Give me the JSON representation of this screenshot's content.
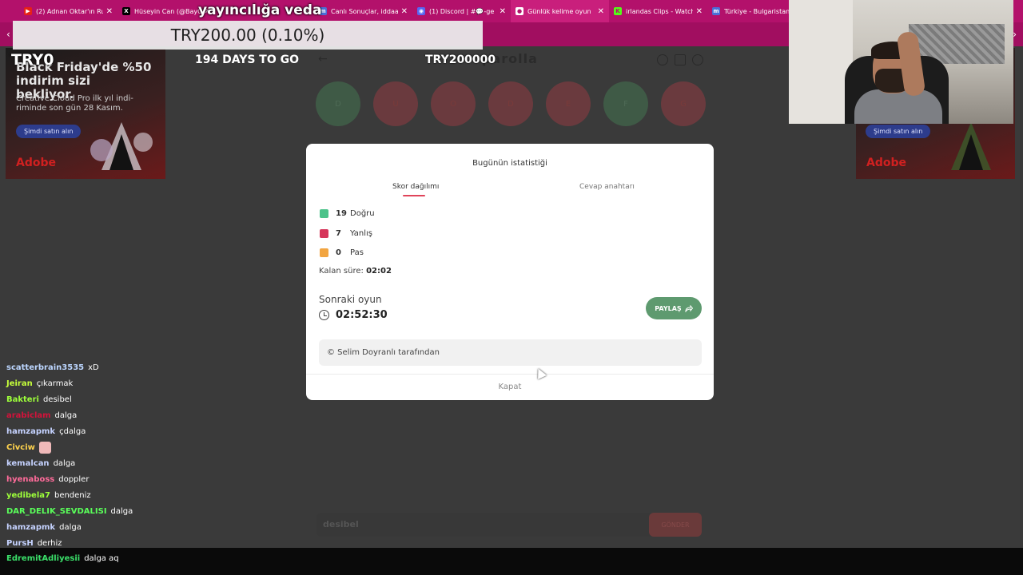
{
  "browser": {
    "tabs": [
      {
        "title": "(2) Adnan Oktar'ın Ru",
        "icon": "youtube-icon",
        "color": "#e62117",
        "glyph": "▶"
      },
      {
        "title": "Hüseyin Can (@BayC",
        "icon": "x-icon",
        "color": "#000000",
        "glyph": "X"
      },
      {
        "title": "",
        "icon": "blank-icon",
        "color": "#b3116b",
        "glyph": ""
      },
      {
        "title": "Canlı Sonuçlar, iddaa",
        "icon": "mackolik-icon",
        "color": "#4a6fd8",
        "glyph": "m"
      },
      {
        "title": "(1) Discord | #💬-ge",
        "icon": "discord-icon",
        "color": "#5865f2",
        "glyph": "◉"
      },
      {
        "title": "Günlük kelime oyun",
        "icon": "parolla-icon",
        "color": "#ffffff",
        "glyph": "●"
      },
      {
        "title": "irlandas Clips - Watch",
        "icon": "kick-icon",
        "color": "#53fc18",
        "glyph": "K"
      },
      {
        "title": "Türkiye - Bulgaristan",
        "icon": "mackolik-icon",
        "color": "#4a6fd8",
        "glyph": "m"
      }
    ],
    "colors": {
      "tabbar": "#b3116b"
    }
  },
  "overlay": {
    "stream_title": "yayıncılığa veda",
    "donation_banner": "TRY200.00 (0.10%)",
    "donation_total_left": "TRY0",
    "donation_goal": "TRY200000",
    "countdown": "194 DAYS TO GO"
  },
  "ads": {
    "left": {
      "headline": "Black Friday'de %50 indirim sizi bekliyor.",
      "sub": "Creative Cloud Pro ilk yıl indi-riminde son gün 28 Kasım.",
      "button": "Şimdi satın alın",
      "brand": "Adobe"
    },
    "right": {
      "button": "Şimdi satın alın",
      "brand": "Adobe"
    }
  },
  "game": {
    "logo": "parolla",
    "circle_letters": [
      "D",
      "U",
      "O",
      "D",
      "E",
      "F",
      "G"
    ],
    "input_value": "desibel",
    "input_button": "GÖNDER"
  },
  "modal": {
    "title": "Bugünün istatistiği",
    "tabs": [
      "Skor dağılımı",
      "Cevap anahtarı"
    ],
    "stats": [
      {
        "count": "19",
        "label": "Doğru",
        "color": "#4cc38a"
      },
      {
        "count": "7",
        "label": "Yanlış",
        "color": "#d6365a"
      },
      {
        "count": "0",
        "label": "Pas",
        "color": "#f2a541"
      }
    ],
    "remaining_label": "Kalan süre:",
    "remaining_value": "02:02",
    "next_game_label": "Sonraki oyun",
    "next_game_time": "02:52:30",
    "share_button": "PAYLAŞ",
    "credit": "© Selim Doyranlı tarafından",
    "close_button": "Kapat"
  },
  "chat": {
    "messages": [
      {
        "user": "scatterbrain3535",
        "color": "#bcd6ff",
        "text": "xD"
      },
      {
        "user": "Jeiran",
        "color": "#c6ff3a",
        "text": "çıkarmak"
      },
      {
        "user": "Bakteri",
        "color": "#9dff3a",
        "text": "desibel"
      },
      {
        "user": "arabiclam",
        "color": "#d4123a",
        "text": "dalga"
      },
      {
        "user": "hamzapmk",
        "color": "#c5d2ff",
        "text": "çdalga"
      },
      {
        "user": "Civciw",
        "color": "#ffd34d",
        "text": "",
        "emote": true
      },
      {
        "user": "kemalcan",
        "color": "#c5d2ff",
        "text": "dalga"
      },
      {
        "user": "hyenaboss",
        "color": "#ff6b9a",
        "text": "doppler"
      },
      {
        "user": "yedibela7",
        "color": "#9dff3a",
        "text": "bendeniz"
      },
      {
        "user": "DAR_DELIK_SEVDALISI",
        "color": "#5aff5a",
        "text": "dalga"
      },
      {
        "user": "hamzapmk",
        "color": "#c5d2ff",
        "text": "dalga"
      },
      {
        "user": "PursH",
        "color": "#c5d2ff",
        "text": "derhiz"
      }
    ],
    "last": {
      "user": "EdremitAdliyesii",
      "color": "#3be06a",
      "text": "dalga aq"
    }
  }
}
